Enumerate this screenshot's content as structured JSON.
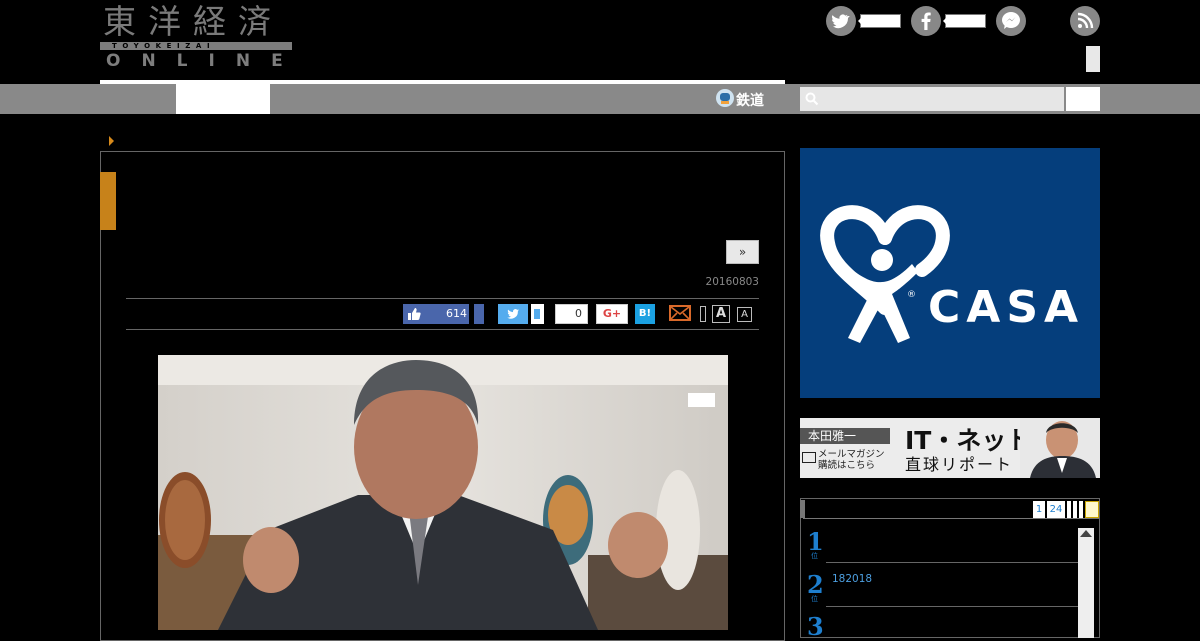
{
  "header": {
    "logo_kanji": "東洋経済",
    "logo_roman": "TOYOKEIZAI",
    "logo_online": "ONLINE",
    "social": [
      "twitter-icon",
      "facebook-icon",
      "messenger-icon",
      "rss-icon"
    ]
  },
  "nav": {
    "rail_tab_label": "鉄道",
    "search_placeholder": ""
  },
  "article": {
    "next_label": "»",
    "date": "20160803",
    "share": {
      "facebook_count": "614",
      "google_count": "0",
      "google_label": "G+",
      "hatena_label": "B!",
      "font_large": "A",
      "font_small": "A"
    }
  },
  "sidebar": {
    "ad_casa_text": "CASA",
    "banner": {
      "name": "本田雅一",
      "sub_line1": "メールマガジン",
      "sub_line2": "購読はこちら",
      "title": "IT・ネット",
      "subtitle": "直球リポート"
    },
    "ranking": {
      "tabs": [
        "1",
        "24"
      ],
      "items": [
        {
          "rank": "1",
          "text": ""
        },
        {
          "rank": "2",
          "text": "182018"
        },
        {
          "rank": "3",
          "text": ""
        }
      ]
    }
  },
  "colors": {
    "accent_orange": "#c7821a",
    "nav_gray": "#898989",
    "casa_blue": "#053e7c",
    "facebook_blue": "#4a66ab",
    "twitter_blue": "#55acee",
    "rank_blue": "#1e7fcf"
  }
}
